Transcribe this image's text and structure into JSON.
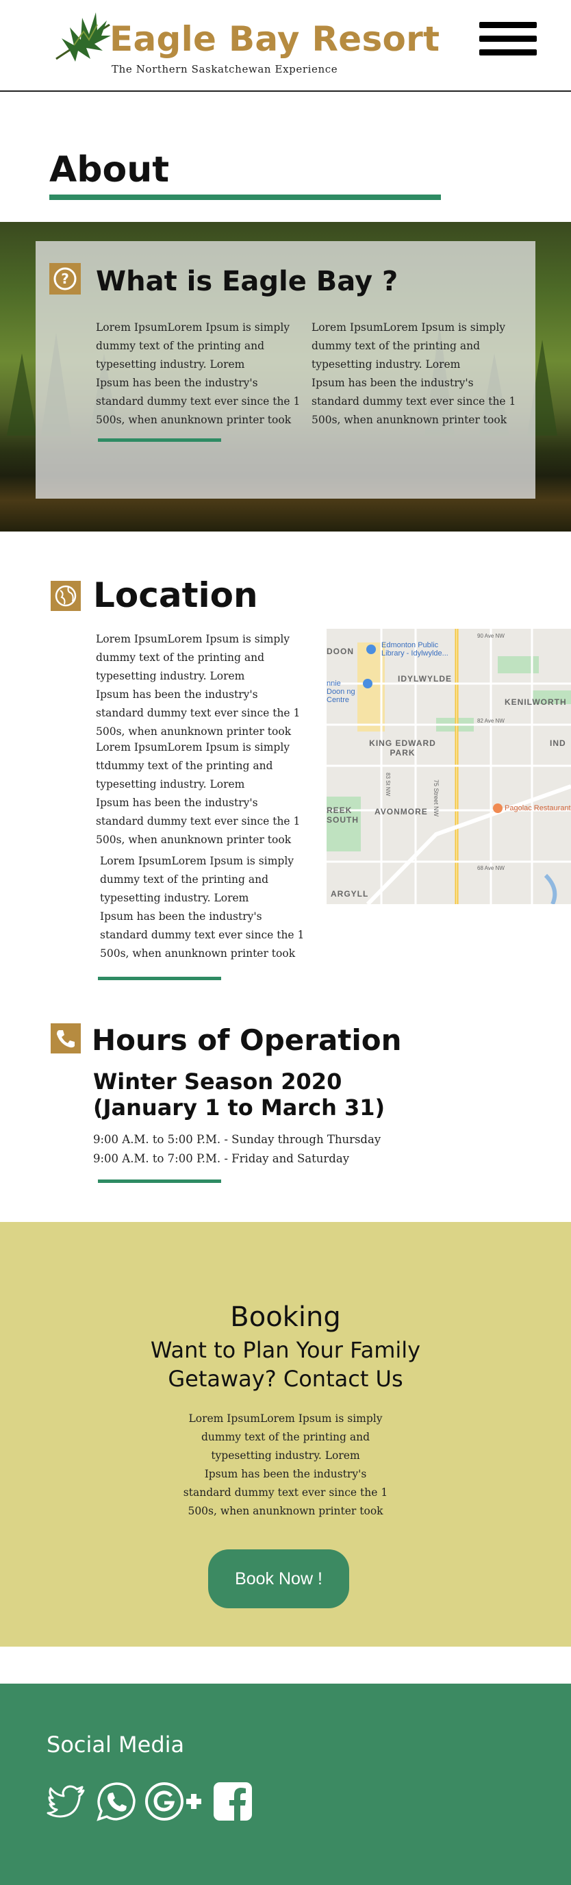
{
  "header": {
    "brand_title": "Eagle Bay Resort",
    "tagline": "The Northern Saskatchewan Experience",
    "menu_label": "menu"
  },
  "about": {
    "heading": "About",
    "card": {
      "title": "What is Eagle Bay ?",
      "col_left": [
        "Lorem IpsumLorem Ipsum is simply",
        " dummy text of the printing and",
        "typesetting industry. Lorem",
        "Ipsum has been the industry's",
        "standard dummy text ever since the 1",
        "500s, when anunknown printer took"
      ],
      "col_right": [
        "Lorem IpsumLorem Ipsum is simply",
        " dummy text of the printing and",
        "typesetting industry. Lorem",
        "Ipsum has been the industry's",
        "standard dummy text ever since the 1",
        "500s, when anunknown printer took"
      ]
    }
  },
  "location": {
    "title": "Location",
    "para1": [
      "Lorem IpsumLorem Ipsum is simply",
      " dummy text of the printing and",
      "typesetting industry. Lorem",
      "Ipsum has been the industry's",
      "standard dummy text ever since the 1",
      "500s, when anunknown printer took"
    ],
    "para2": [
      "Lorem IpsumLorem Ipsum is simply",
      "ttdummy text of the printing and",
      "typesetting industry. Lorem",
      "Ipsum has been the industry's",
      "standard dummy text ever since the 1",
      "500s, when anunknown printer took"
    ],
    "para3": [
      "Lorem IpsumLorem Ipsum is simply",
      " dummy text of the printing and",
      "typesetting industry. Lorem",
      "Ipsum has been the industry's",
      "standard dummy text ever since the 1",
      "500s, when anunknown printer took"
    ],
    "map_labels": {
      "library": "Edmonton Public Library - Idylwylde...",
      "idylwylde": "IDYLWYLDE",
      "kenilworth": "KENILWORTH",
      "king_edward": "KING EDWARD PARK",
      "avonmore": "AVONMORE",
      "argyll": "ARGYLL",
      "creek_south": "REEK SOUTH",
      "doon": "DOON",
      "pagolac": "Pagolac Restaurant",
      "street_75": "75 Street NW",
      "ave_90": "90 Ave NW",
      "ave_82": "82 Ave NW",
      "ave_68": "68 Ave NW",
      "st_83": "83 St NW",
      "ind": "IND",
      "nnie_doon": "nnie Doon ng Centre"
    }
  },
  "hours": {
    "title": "Hours of Operation",
    "season": "Winter Season 2020",
    "range": "(January 1 to March 31)",
    "line1": "9:00 A.M. to 5:00 P.M. - Sunday through Thursday",
    "line2": "9:00 A.M. to 7:00 P.M. - Friday and Saturday"
  },
  "booking": {
    "title": "Booking",
    "subtitle_1": "Want to Plan Your Family",
    "subtitle_2": "Getaway? Contact Us",
    "para": [
      "Lorem IpsumLorem Ipsum is simply",
      "dummy text of the printing and",
      "typesetting industry. Lorem",
      "Ipsum has been the industry's",
      "standard dummy text ever since the 1",
      "500s, when anunknown printer took"
    ],
    "button_label": "Book Now !"
  },
  "footer": {
    "social_title": "Social Media",
    "icons": [
      "twitter-icon",
      "whatsapp-icon",
      "google-plus-icon",
      "facebook-icon"
    ]
  },
  "colors": {
    "brand_gold": "#b68b40",
    "accent_green": "#2e8b63",
    "footer_green": "#3c8a62",
    "booking_yellow": "#dbd487"
  }
}
